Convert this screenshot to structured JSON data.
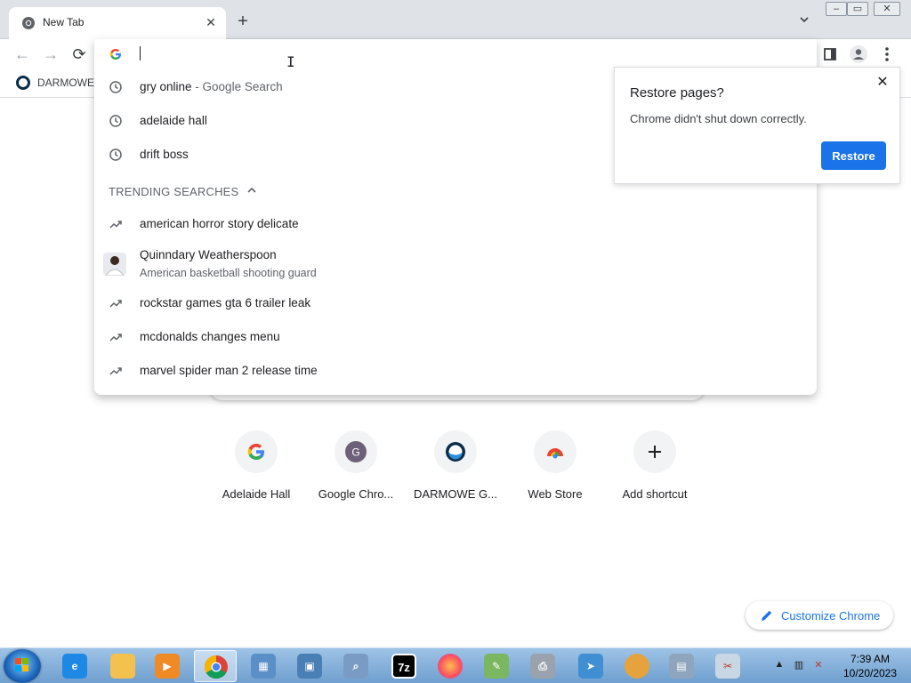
{
  "browser": {
    "tab_title": "New Tab",
    "bookmark_label": "DARMOWE"
  },
  "omnibox": {
    "input_value": "",
    "suggestions": [
      {
        "text": "gry online",
        "suffix": " - Google Search",
        "icon": "history-icon"
      },
      {
        "text": "adelaide hall",
        "suffix": "",
        "icon": "history-icon"
      },
      {
        "text": "drift boss",
        "suffix": "",
        "icon": "history-icon"
      }
    ],
    "trending_header": "TRENDING SEARCHES",
    "trending": [
      {
        "text": "american horror story delicate",
        "icon": "trending-icon"
      },
      {
        "text": "rockstar games gta 6 trailer leak",
        "icon": "trending-icon"
      },
      {
        "text": "mcdonalds changes menu",
        "icon": "trending-icon"
      },
      {
        "text": "marvel spider man 2 release time",
        "icon": "trending-icon"
      }
    ],
    "person": {
      "name": "Quinndary Weatherspoon",
      "description": "American basketball shooting guard"
    }
  },
  "shortcuts": [
    {
      "label": "Adelaide Hall",
      "icon": "google-g-icon"
    },
    {
      "label": "Google Chro...",
      "icon": "letter-g-icon"
    },
    {
      "label": "DARMOWE G...",
      "icon": "darmowe-icon"
    },
    {
      "label": "Web Store",
      "icon": "web-store-icon"
    },
    {
      "label": "Add shortcut",
      "icon": "plus-icon"
    }
  ],
  "customize": {
    "label": "Customize Chrome"
  },
  "restore_popup": {
    "title": "Restore pages?",
    "message": "Chrome didn't shut down correctly.",
    "button": "Restore"
  },
  "taskbar": {
    "time": "7:39 AM",
    "date": "10/20/2023",
    "seven_zip_label": "7z"
  },
  "colors": {
    "accent": "#1a73e8",
    "text": "#202124",
    "muted": "#5f6368"
  }
}
